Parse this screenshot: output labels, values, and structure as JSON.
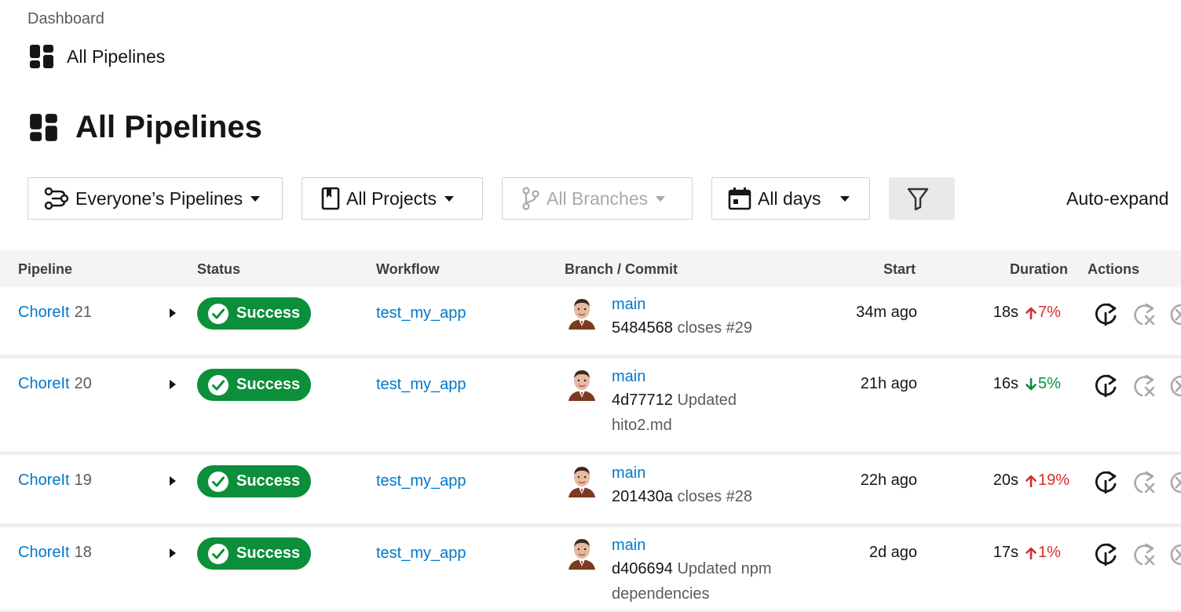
{
  "breadcrumb": {
    "root": "Dashboard",
    "current": "All Pipelines"
  },
  "page": {
    "title": "All Pipelines"
  },
  "filters": {
    "pipelines": "Everyone’s Pipelines",
    "projects": "All Projects",
    "branches": "All Branches",
    "days": "All days",
    "auto_expand": "Auto-expand"
  },
  "table": {
    "headers": {
      "pipeline": "Pipeline",
      "status": "Status",
      "workflow": "Workflow",
      "branch_commit": "Branch / Commit",
      "start": "Start",
      "duration": "Duration",
      "actions": "Actions"
    },
    "rows": [
      {
        "project": "ChoreIt",
        "number": "21",
        "status": "Success",
        "workflow": "test_my_app",
        "branch": "main",
        "commit_hash": "5484568",
        "commit_msg": "closes #29",
        "start": "34m ago",
        "duration": "18s",
        "delta": "7%",
        "delta_dir": "up"
      },
      {
        "project": "ChoreIt",
        "number": "20",
        "status": "Success",
        "workflow": "test_my_app",
        "branch": "main",
        "commit_hash": "4d77712",
        "commit_msg": "Updated hito2.md",
        "start": "21h ago",
        "duration": "16s",
        "delta": "5%",
        "delta_dir": "down"
      },
      {
        "project": "ChoreIt",
        "number": "19",
        "status": "Success",
        "workflow": "test_my_app",
        "branch": "main",
        "commit_hash": "201430a",
        "commit_msg": "closes #28",
        "start": "22h ago",
        "duration": "20s",
        "delta": "19%",
        "delta_dir": "up"
      },
      {
        "project": "ChoreIt",
        "number": "18",
        "status": "Success",
        "workflow": "test_my_app",
        "branch": "main",
        "commit_hash": "d406694",
        "commit_msg": "Updated npm dependencies",
        "start": "2d ago",
        "duration": "17s",
        "delta": "1%",
        "delta_dir": "up"
      }
    ]
  },
  "colors": {
    "link": "#0078ca",
    "success": "#0b8f3a",
    "up": "#d32f2f",
    "down": "#0b8f3a"
  }
}
